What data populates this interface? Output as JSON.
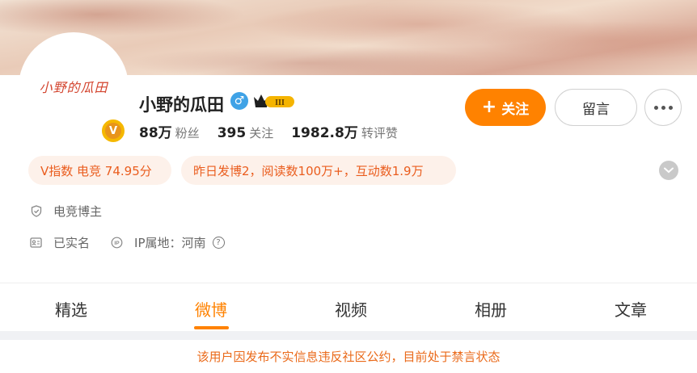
{
  "profile": {
    "avatar_text": "小野的瓜田",
    "verify_badge": "V",
    "name": "小野的瓜田",
    "gender_icon": "♂",
    "vip_level": "III",
    "stats": [
      {
        "value": "88万",
        "label": "粉丝"
      },
      {
        "value": "395",
        "label": "关注"
      },
      {
        "value": "1982.8万",
        "label": "转评赞"
      }
    ]
  },
  "actions": {
    "follow_label": "关注",
    "message_label": "留言"
  },
  "pills": {
    "v_index": "V指数 电竞 74.95分",
    "activity": "昨日发博2，阅读数100万+，互动数1.9万"
  },
  "info": {
    "category": "电竞博主",
    "real_name": "已实名",
    "ip_location": "IP属地：河南"
  },
  "tabs": [
    {
      "label": "精选"
    },
    {
      "label": "微博"
    },
    {
      "label": "视频"
    },
    {
      "label": "相册"
    },
    {
      "label": "文章"
    }
  ],
  "active_tab": "微博",
  "notice": "该用户因发布不实信息违反社区公约，目前处于禁言状态",
  "colors": {
    "accent": "#ff8200",
    "pill_bg": "#fdf1ea",
    "pill_text": "#ea5d1e",
    "gender": "#3fa2e6"
  }
}
